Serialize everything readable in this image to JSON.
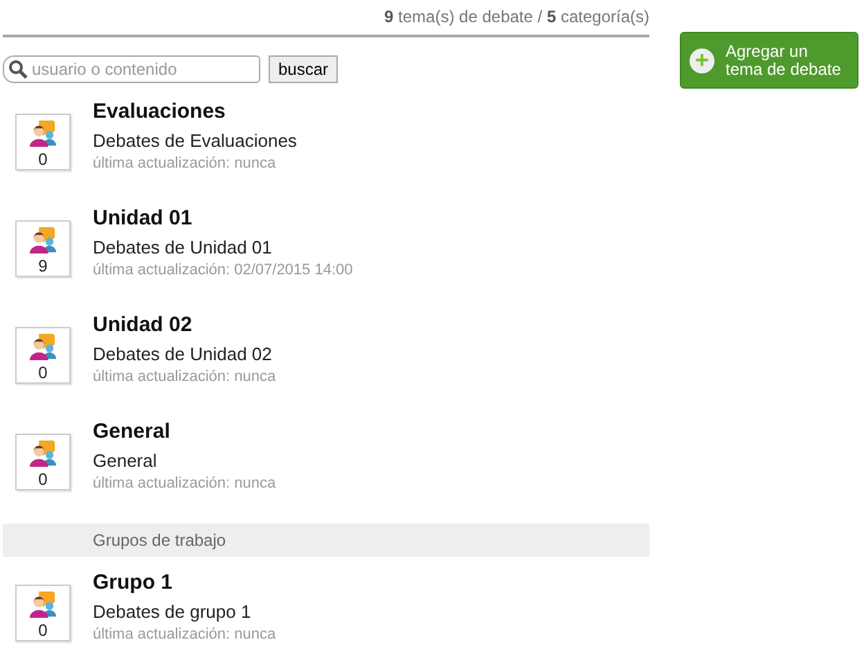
{
  "summary": "**9** tema(s) de debate / **5** categoría(s)",
  "search": {
    "placeholder": "usuario o contenido",
    "button": "buscar"
  },
  "add_button": {
    "label": "Agregar un tema de debate",
    "icon": "+"
  },
  "entries": [
    {
      "kind": "forum",
      "count": "0",
      "title": "Evaluaciones",
      "description": "Debates de Evaluaciones",
      "updated": "última actualización: nunca"
    },
    {
      "kind": "forum",
      "count": "9",
      "title": "Unidad 01",
      "description": "Debates de Unidad 01",
      "updated": "última actualización: 02/07/2015 14:00"
    },
    {
      "kind": "forum",
      "count": "0",
      "title": "Unidad 02",
      "description": "Debates de Unidad 02",
      "updated": "última actualización: nunca"
    },
    {
      "kind": "forum",
      "count": "0",
      "title": "General",
      "description": "General",
      "updated": "última actualización: nunca"
    },
    {
      "kind": "section",
      "title": "Grupos de trabajo"
    },
    {
      "kind": "forum",
      "count": "0",
      "title": "Grupo 1",
      "description": "Debates de grupo 1",
      "updated": "última actualización: nunca"
    }
  ]
}
